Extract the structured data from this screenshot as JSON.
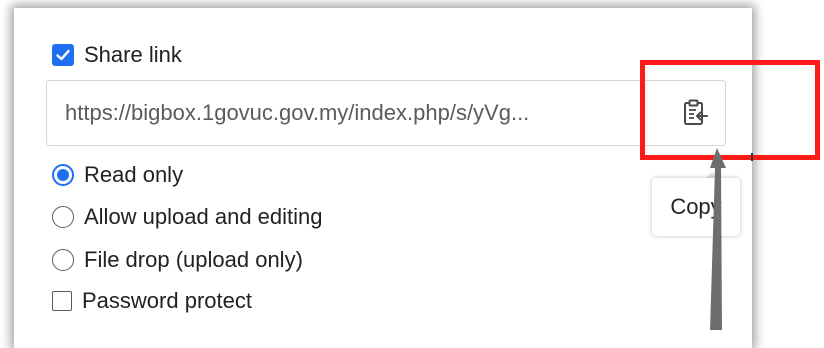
{
  "share": {
    "checkbox_label": "Share link",
    "checked": true,
    "url": "https://bigbox.1govuc.gov.my/index.php/s/yVg...",
    "copy_tooltip": "Copy"
  },
  "options": [
    {
      "label": "Read only",
      "selected": true
    },
    {
      "label": "Allow upload and editing",
      "selected": false
    },
    {
      "label": "File drop (upload only)",
      "selected": false
    }
  ],
  "password": {
    "label": "Password protect",
    "checked": false
  },
  "colors": {
    "accent": "#1f6ff2",
    "highlight": "#ff1a1a",
    "pointer": "#6e6e6e"
  }
}
